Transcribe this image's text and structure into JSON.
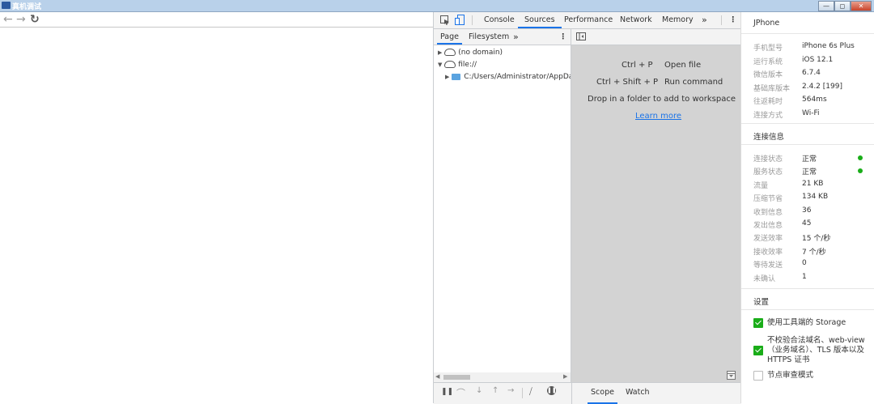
{
  "window": {
    "title": "真机调试",
    "buttons": [
      "—",
      "◻",
      "✕"
    ]
  },
  "nav": {
    "icons": [
      "arrow-left-icon",
      "arrow-right-icon",
      "reload-icon"
    ]
  },
  "devtools": {
    "tabs": [
      "Console",
      "Sources",
      "Performance",
      "Network",
      "Memory"
    ],
    "more": "»",
    "active_tab": "Sources",
    "left_tabs": [
      "Page",
      "Filesystem"
    ],
    "left_more": "»",
    "tree": {
      "no_domain": "(no domain)",
      "file": "file://",
      "path": "C:/Users/Administrator/AppData/"
    },
    "shortcuts": [
      {
        "keys": "Ctrl + P",
        "action": "Open file"
      },
      {
        "keys": "Ctrl + Shift + P",
        "action": "Run command"
      }
    ],
    "drop_text": "Drop in a folder to add to workspace",
    "learn_more": "Learn more",
    "bottom_tabs": [
      "Scope",
      "Watch"
    ]
  },
  "panel": {
    "device_title": "JPhone",
    "device_info": [
      {
        "label": "手机型号",
        "value": "iPhone 6s Plus"
      },
      {
        "label": "运行系统",
        "value": "iOS 12.1"
      },
      {
        "label": "微信版本",
        "value": "6.7.4"
      },
      {
        "label": "基础库版本",
        "value": "2.4.2 [199]"
      },
      {
        "label": "往返耗时",
        "value": "564ms"
      },
      {
        "label": "连接方式",
        "value": "Wi-Fi"
      }
    ],
    "connection_title": "连接信息",
    "connection_info": [
      {
        "label": "连接状态",
        "value": "正常"
      },
      {
        "label": "服务状态",
        "value": "正常"
      },
      {
        "label": "流量",
        "value": "21 KB"
      },
      {
        "label": "压缩节省",
        "value": "134 KB"
      },
      {
        "label": "收到信息",
        "value": "36"
      },
      {
        "label": "发出信息",
        "value": "45"
      },
      {
        "label": "发送效率",
        "value": "15 个/秒"
      },
      {
        "label": "接收效率",
        "value": "7 个/秒"
      },
      {
        "label": "等待发送",
        "value": "0"
      },
      {
        "label": "未确认",
        "value": "1"
      }
    ],
    "settings_title": "设置",
    "settings": [
      {
        "label": "使用工具端的 Storage",
        "checked": true
      },
      {
        "label": "不校验合法域名、web-view（业务域名）、TLS 版本以及 HTTPS 证书",
        "checked": true
      },
      {
        "label": "节点审查模式",
        "checked": false
      }
    ],
    "status_color": "#1aad19"
  }
}
